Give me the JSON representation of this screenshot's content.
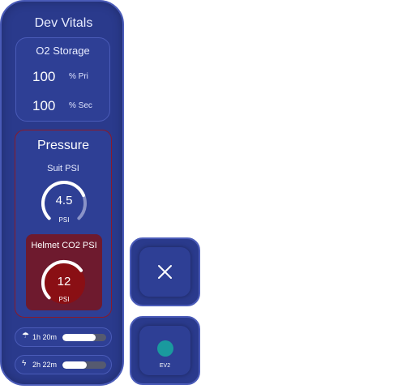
{
  "panel": {
    "title": "Dev Vitals"
  },
  "o2": {
    "title": "O2 Storage",
    "primary": {
      "value": "100",
      "unit": "% Pri"
    },
    "secondary": {
      "value": "100",
      "unit": "% Sec"
    }
  },
  "pressure": {
    "title": "Pressure",
    "suit": {
      "label": "Suit PSI",
      "value": "4.5",
      "unit": "PSI",
      "level": 0.75
    },
    "helmet_co2": {
      "label": "Helmet CO2 PSI",
      "value": "12",
      "unit": "PSI",
      "level": 0.7
    }
  },
  "resources": [
    {
      "icon": "oxygen-drop-icon",
      "glyph": "☂",
      "text": "1h 20m",
      "level": 0.75
    },
    {
      "icon": "battery-bolt-icon",
      "glyph": "ϟ",
      "text": "2h 22m",
      "level": 0.55
    }
  ],
  "buttons": {
    "close": {
      "icon": "close-icon"
    },
    "ev": {
      "label": "EV2",
      "dot_color": "#1a9a9e"
    }
  },
  "colors": {
    "panel": "#2a3a8c",
    "border": "#4a5bb8",
    "alert": "#6e1a2e",
    "accent": "#1a9a9e"
  }
}
